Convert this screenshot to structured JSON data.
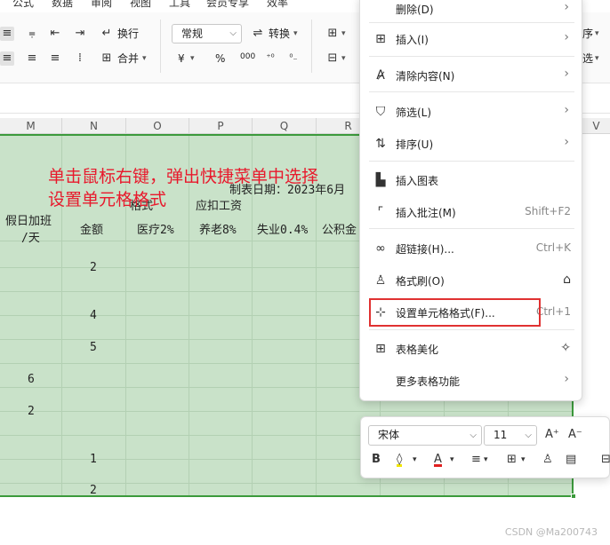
{
  "menu_strip": {
    "items": [
      "公式",
      "数据",
      "审阅",
      "视图",
      "工具",
      "会员专享",
      "效率"
    ]
  },
  "ribbon": {
    "wrap_label": "换行",
    "convert_label": "转换",
    "merge_label": "合并",
    "number_format": "常规",
    "currency_symbol": "¥",
    "percent_symbol": "%",
    "thousands_symbol": "000",
    "sort_partial": "序",
    "filter_partial": "选"
  },
  "columns": [
    "M",
    "N",
    "O",
    "P",
    "Q",
    "R",
    "V"
  ],
  "sheet": {
    "header_date": "制表日期：2023年6月",
    "header_group_left": "格式",
    "header_group_right": "应扣工资",
    "header_holiday": "假日加班",
    "header_holiday_unit": "/天",
    "header_amount": "金额",
    "header_medical": "医疗2%",
    "header_pension": "养老8%",
    "header_unemployment": "失业0.4%",
    "header_fund": "公积金",
    "col_n_values": [
      "2",
      "4",
      "5",
      "1",
      "2"
    ],
    "col_m_values": [
      "6",
      "2"
    ]
  },
  "annotation": {
    "line1": "单击鼠标右键，弹出快捷菜单中选择",
    "line2": "设置单元格格式"
  },
  "context_menu": {
    "items": [
      {
        "label": "删除(D)",
        "icon": "delete-icon",
        "has_submenu": true,
        "shortcut": ""
      },
      {
        "label": "插入(I)",
        "icon": "insert-icon",
        "has_submenu": true,
        "shortcut": ""
      },
      {
        "label": "清除内容(N)",
        "icon": "clear-icon",
        "has_submenu": true,
        "shortcut": ""
      },
      {
        "label": "筛选(L)",
        "icon": "filter-icon",
        "has_submenu": true,
        "shortcut": ""
      },
      {
        "label": "排序(U)",
        "icon": "sort-icon",
        "has_submenu": true,
        "shortcut": ""
      },
      {
        "label": "插入图表",
        "icon": "chart-icon",
        "has_submenu": false,
        "shortcut": ""
      },
      {
        "label": "插入批注(M)",
        "icon": "comment-icon",
        "has_submenu": false,
        "shortcut": "Shift+F2"
      },
      {
        "label": "超链接(H)...",
        "icon": "link-icon",
        "has_submenu": false,
        "shortcut": "Ctrl+K"
      },
      {
        "label": "格式刷(O)",
        "icon": "format-painter-icon",
        "has_submenu": false,
        "shortcut": ""
      },
      {
        "label": "设置单元格格式(F)...",
        "icon": "format-cells-icon",
        "has_submenu": false,
        "shortcut": "Ctrl+1"
      },
      {
        "label": "表格美化",
        "icon": "beautify-icon",
        "has_submenu": false,
        "shortcut": ""
      },
      {
        "label": "更多表格功能",
        "icon": "",
        "has_submenu": true,
        "shortcut": ""
      }
    ],
    "highlight_color": "#e03131"
  },
  "mini_toolbar": {
    "font_name": "宋体",
    "font_size": "11",
    "bold_label": "B"
  },
  "watermark": "CSDN @Ma200743",
  "colors": {
    "selection_fill": "#c9e2c9",
    "selection_border": "#3c9a3c",
    "annotation": "#e8192c"
  }
}
